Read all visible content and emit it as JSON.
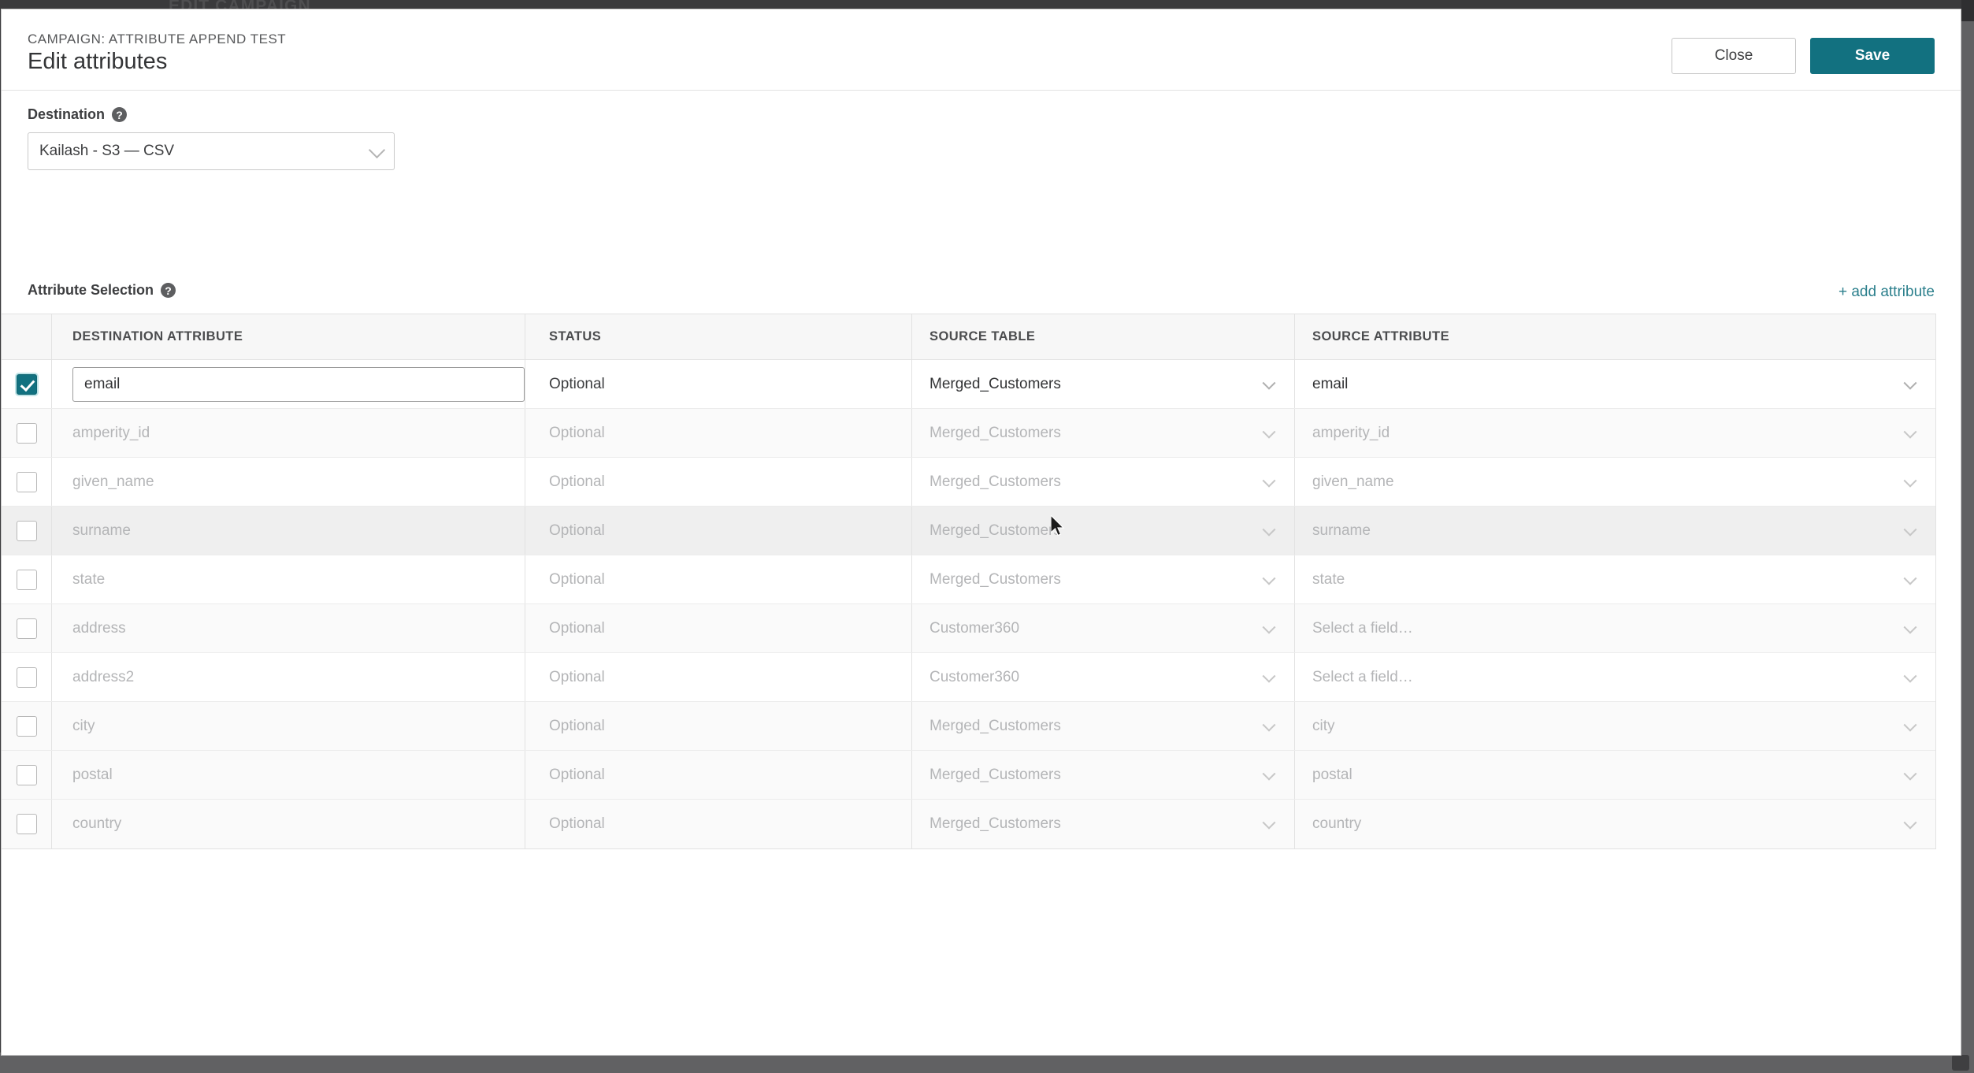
{
  "backdrop": {
    "page_title": "EDIT CAMPAIGN"
  },
  "modal": {
    "eyebrow": "CAMPAIGN: ATTRIBUTE APPEND TEST",
    "title": "Edit attributes",
    "close_label": "Close",
    "save_label": "Save"
  },
  "destination": {
    "label": "Destination",
    "help_icon": "help-circle-icon",
    "value": "Kailash - S3 — CSV"
  },
  "attribute_selection": {
    "label": "Attribute Selection",
    "help_icon": "help-circle-icon",
    "add_link": "+ add attribute"
  },
  "table": {
    "columns": [
      "DESTINATION ATTRIBUTE",
      "STATUS",
      "SOURCE TABLE",
      "SOURCE ATTRIBUTE"
    ],
    "rows": [
      {
        "checked": true,
        "enabled": true,
        "is_input": true,
        "destination_attribute": "email",
        "status": "Optional",
        "source_table": "Merged_Customers",
        "source_attribute": "email",
        "row_state": "selected"
      },
      {
        "checked": false,
        "enabled": false,
        "is_input": false,
        "destination_attribute": "amperity_id",
        "status": "Optional",
        "source_table": "Merged_Customers",
        "source_attribute": "amperity_id",
        "row_state": "alt"
      },
      {
        "checked": false,
        "enabled": false,
        "is_input": false,
        "destination_attribute": "given_name",
        "status": "Optional",
        "source_table": "Merged_Customers",
        "source_attribute": "given_name",
        "row_state": "plain"
      },
      {
        "checked": false,
        "enabled": false,
        "is_input": false,
        "destination_attribute": "surname",
        "status": "Optional",
        "source_table": "Merged_Customers",
        "source_attribute": "surname",
        "row_state": "hovered"
      },
      {
        "checked": false,
        "enabled": false,
        "is_input": false,
        "destination_attribute": "state",
        "status": "Optional",
        "source_table": "Merged_Customers",
        "source_attribute": "state",
        "row_state": "plain"
      },
      {
        "checked": false,
        "enabled": false,
        "is_input": false,
        "destination_attribute": "address",
        "status": "Optional",
        "source_table": "Customer360",
        "source_attribute": "Select a field…",
        "row_state": "alt"
      },
      {
        "checked": false,
        "enabled": false,
        "is_input": false,
        "destination_attribute": "address2",
        "status": "Optional",
        "source_table": "Customer360",
        "source_attribute": "Select a field…",
        "row_state": "plain"
      },
      {
        "checked": false,
        "enabled": false,
        "is_input": false,
        "destination_attribute": "city",
        "status": "Optional",
        "source_table": "Merged_Customers",
        "source_attribute": "city",
        "row_state": "alt"
      },
      {
        "checked": false,
        "enabled": false,
        "is_input": false,
        "destination_attribute": "postal",
        "status": "Optional",
        "source_table": "Merged_Customers",
        "source_attribute": "postal",
        "row_state": "alt"
      },
      {
        "checked": false,
        "enabled": false,
        "is_input": false,
        "destination_attribute": "country",
        "status": "Optional",
        "source_table": "Merged_Customers",
        "source_attribute": "country",
        "row_state": "alt"
      }
    ]
  },
  "colors": {
    "accent_teal": "#127180",
    "link_teal": "#2b7f8c",
    "backdrop": "#3a3a3c",
    "muted_text": "#b4b5b7",
    "body_text": "#333436"
  }
}
